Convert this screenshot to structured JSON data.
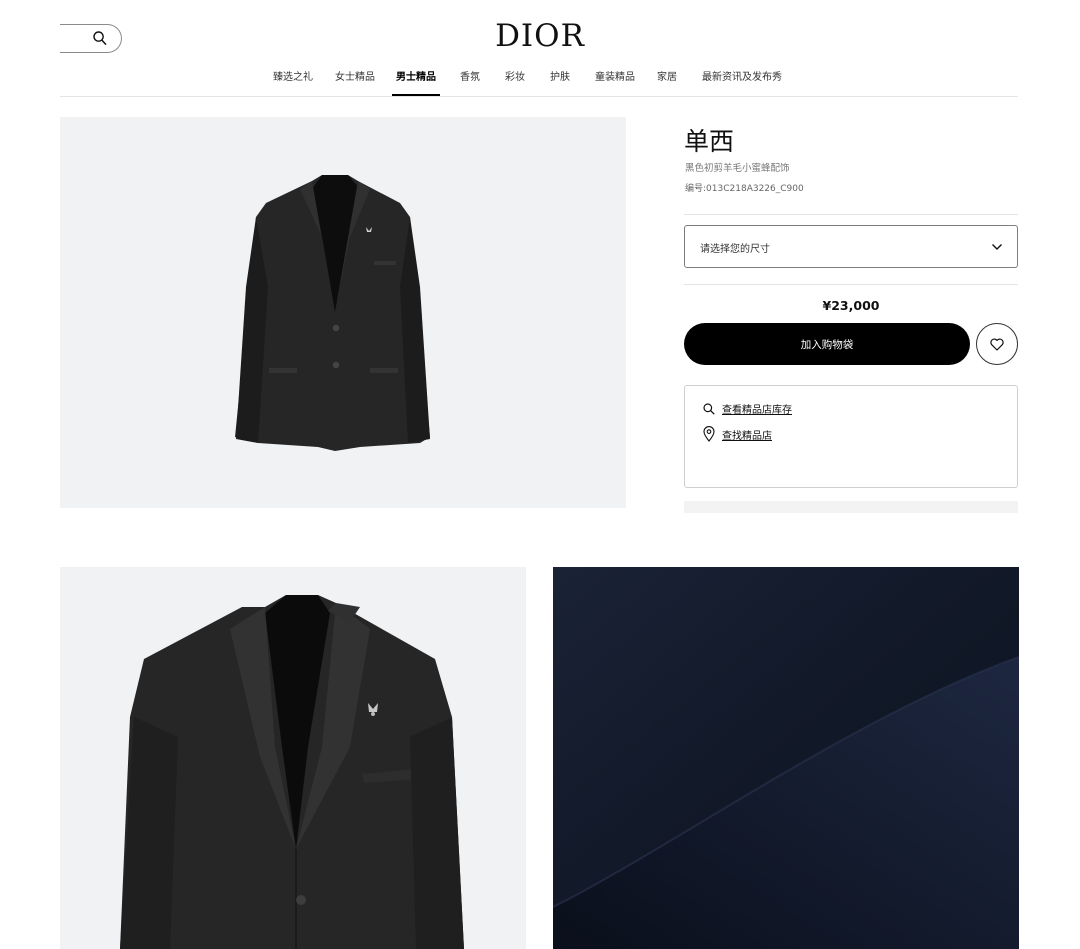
{
  "header": {
    "logo": "DIOR",
    "search_icon": "search-icon",
    "nav": [
      {
        "label": "臻选之礼",
        "active": false
      },
      {
        "label": "女士精品",
        "active": false
      },
      {
        "label": "男士精品",
        "active": true
      },
      {
        "label": "香氛",
        "active": false
      },
      {
        "label": "彩妆",
        "active": false
      },
      {
        "label": "护肤",
        "active": false
      },
      {
        "label": "童装精品",
        "active": false
      },
      {
        "label": "家居",
        "active": false
      },
      {
        "label": "最新资讯及发布秀",
        "active": false
      }
    ]
  },
  "product": {
    "title": "单西",
    "subtitle": "黑色初剪羊毛小蜜蜂配饰",
    "ref_label": "编号:",
    "ref_value": "013C218A3226_C900",
    "size_placeholder": "请选择您的尺寸",
    "price": "¥23,000",
    "add_to_bag": "加入购物袋",
    "wishlist_icon": "heart-icon",
    "store_links": [
      {
        "label": "查看精品店库存",
        "icon": "search-icon"
      },
      {
        "label": "查找精品店",
        "icon": "location-pin-icon"
      }
    ]
  },
  "images": {
    "main": "black-jacket-front",
    "detail_left": "jacket-closeup-with-bee-brooch",
    "detail_right": "navy-wool-fabric-closeup"
  },
  "colors": {
    "primary_button": "#000000",
    "image_bg": "#f1f2f4",
    "fabric": "#141a2a"
  }
}
